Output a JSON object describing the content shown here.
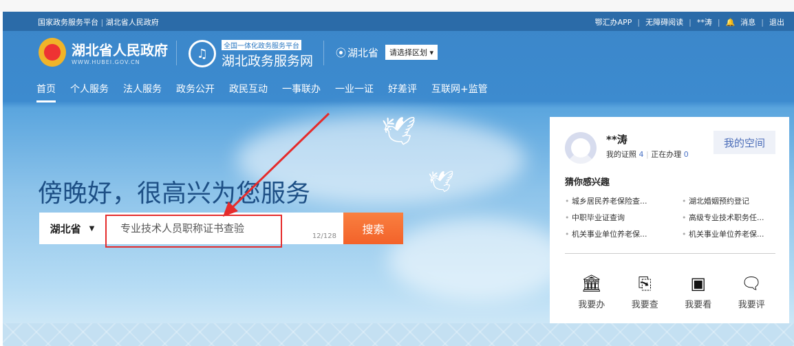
{
  "topbar": {
    "left": [
      "国家政务服务平台",
      "湖北省人民政府"
    ],
    "right": [
      "鄂汇办APP",
      "无障碍阅读",
      "**涛",
      "消息",
      "退出"
    ]
  },
  "logo1": {
    "title": "湖北省人民政府",
    "url": "WWW.HUBEI.GOV.CN"
  },
  "logo2": {
    "badge": "全国一体化政务服务平台",
    "title": "湖北政务服务网"
  },
  "location": {
    "province": "湖北省",
    "region_select": "请选择区划 ▾"
  },
  "nav": [
    "首页",
    "个人服务",
    "法人服务",
    "政务公开",
    "政民互动",
    "一事联办",
    "一业一证",
    "好差评",
    "互联网+监管"
  ],
  "hero": {
    "greeting": "傍晚好，很高兴为您服务"
  },
  "search": {
    "region": "湖北省",
    "value": "专业技术人员职称证书查验",
    "count": "12/128",
    "button": "搜索"
  },
  "user": {
    "name": "**涛",
    "cert_label": "我的证照",
    "cert_count": "4",
    "doing_label": "正在办理",
    "doing_count": "0",
    "space_button": "我的空间"
  },
  "interest": {
    "title": "猜你感兴趣",
    "items": [
      "城乡居民养老保险查...",
      "湖北婚姻预约登记",
      "中职毕业证查询",
      "高级专业技术职务任...",
      "机关事业单位养老保...",
      "机关事业单位养老保..."
    ]
  },
  "actions": [
    {
      "icon": "bank-icon",
      "label": "我要办"
    },
    {
      "icon": "search-doc-icon",
      "label": "我要查"
    },
    {
      "icon": "view-doc-icon",
      "label": "我要看"
    },
    {
      "icon": "comment-check-icon",
      "label": "我要评"
    }
  ],
  "colors": {
    "header": "#3b86c9",
    "topbar": "#2b6ba8",
    "search_button": "#f3622a",
    "highlight": "#e52b2b"
  }
}
